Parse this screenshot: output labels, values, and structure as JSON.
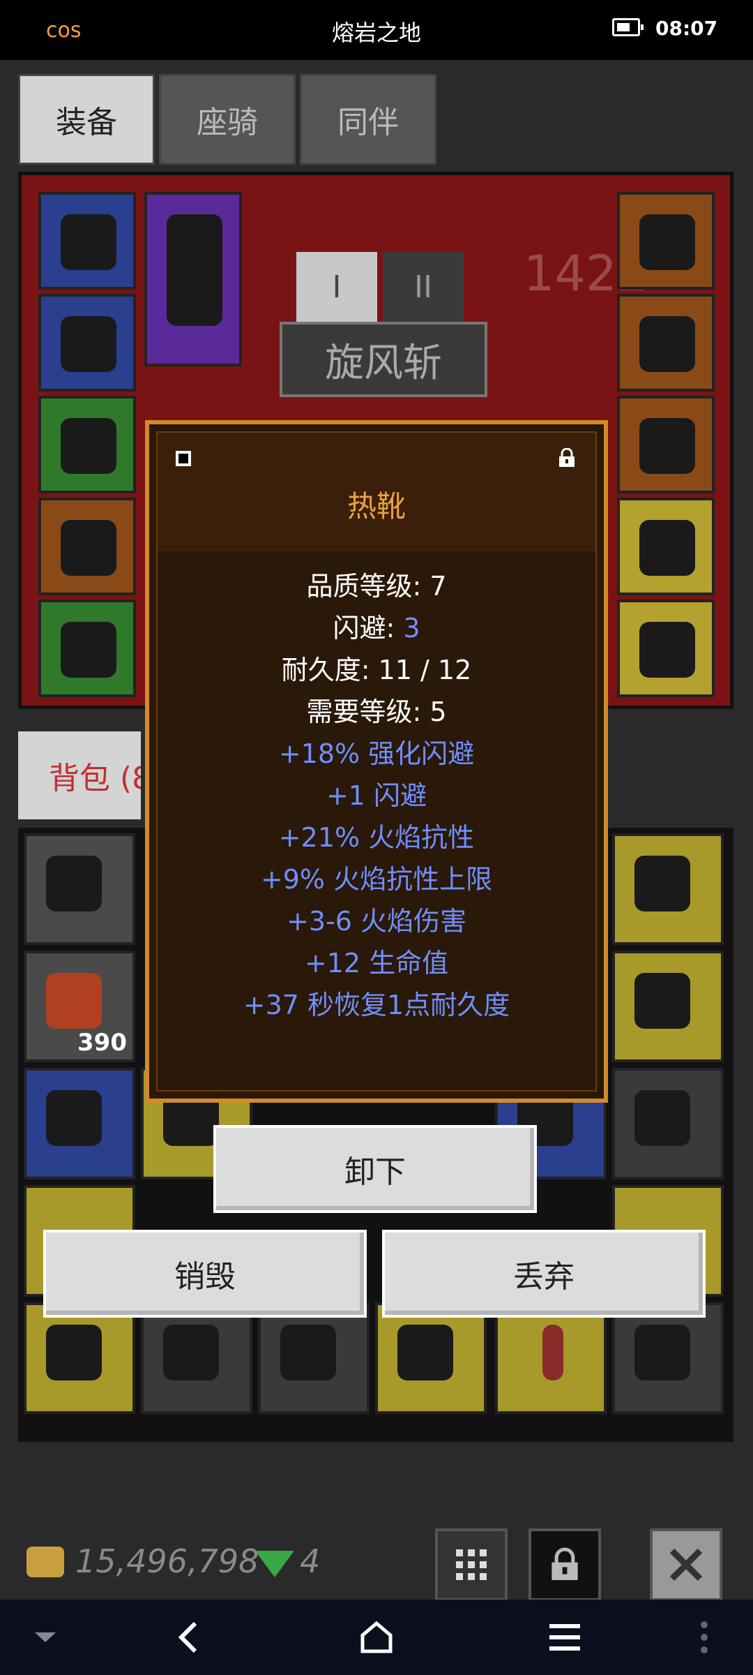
{
  "status": {
    "left": "cos",
    "title": "熔岩之地",
    "time": "08:07"
  },
  "tabs": [
    "装备",
    "座骑",
    "同伴"
  ],
  "equip": {
    "skill_label": "旋风斩",
    "roman_1": "I",
    "roman_2": "II",
    "score_partial": "1422"
  },
  "bag": {
    "tab_label": "背包 (8",
    "count_label": "390"
  },
  "tooltip": {
    "title": "热靴",
    "quality_label": "品质等级: 7",
    "dodge_prefix": "闪避: ",
    "dodge_value": "3",
    "durability": "耐久度: 11 / 12",
    "required_level": "需要等级: 5",
    "mods": [
      "+18% 强化闪避",
      "+1 闪避",
      "+21% 火焰抗性",
      "+9% 火焰抗性上限",
      "+3-6 火焰伤害",
      "+12 生命值",
      "+37 秒恢复1点耐久度"
    ]
  },
  "buttons": {
    "unequip": "卸下",
    "destroy": "销毁",
    "discard": "丢弃"
  },
  "currency": {
    "gold": "15,496,798",
    "gems": "4"
  },
  "colors": {
    "accent": "#f0a040",
    "mod_blue": "#6f8fff",
    "tooltip_border": "#d28a2a"
  },
  "icons": [
    "battery-icon",
    "gold-icon",
    "gem-icon",
    "grid-icon",
    "lock-icon",
    "close-icon",
    "back-icon",
    "home-icon",
    "menu-icon"
  ]
}
